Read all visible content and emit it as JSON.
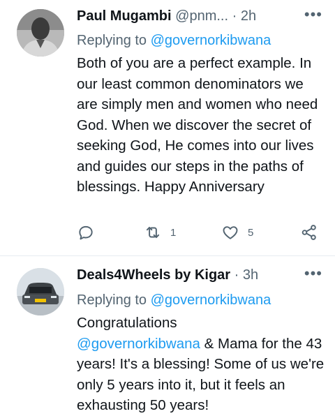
{
  "tweets": [
    {
      "name": "Paul Mugambi",
      "handle": "@pnm...",
      "dot": "·",
      "time": "2h",
      "more": "•••",
      "replying_prefix": "Replying to",
      "replying_to": "@governorkibwana",
      "text": "Both of you are a perfect example. In our least common denominators we are simply men and women who need God. When we discover the secret of seeking God, He comes into our lives and guides our steps in the paths of blessings. Happy Anniversary",
      "actions": {
        "reply_icon": "reply-icon",
        "retweet_icon": "retweet-icon",
        "retweet_count": "1",
        "like_icon": "heart-icon",
        "like_count": "5",
        "share_icon": "share-icon"
      }
    },
    {
      "name": "Deals4Wheels by Kigar",
      "dot": "·",
      "time": "3h",
      "more": "•••",
      "replying_prefix": "Replying to",
      "replying_to": "@governorkibwana",
      "text_line1": "Congratulations",
      "text_mention": "@governorkibwana",
      "text_rest": " & Mama  for the 43 years! It's a blessing! Some of us we're only 5 years into it, but it feels an exhausting 50 years!"
    }
  ],
  "colors": {
    "accent": "#1d9bf0",
    "secondary_text": "#536471",
    "primary_text": "#0f1419",
    "divider": "#e6ecf0"
  }
}
